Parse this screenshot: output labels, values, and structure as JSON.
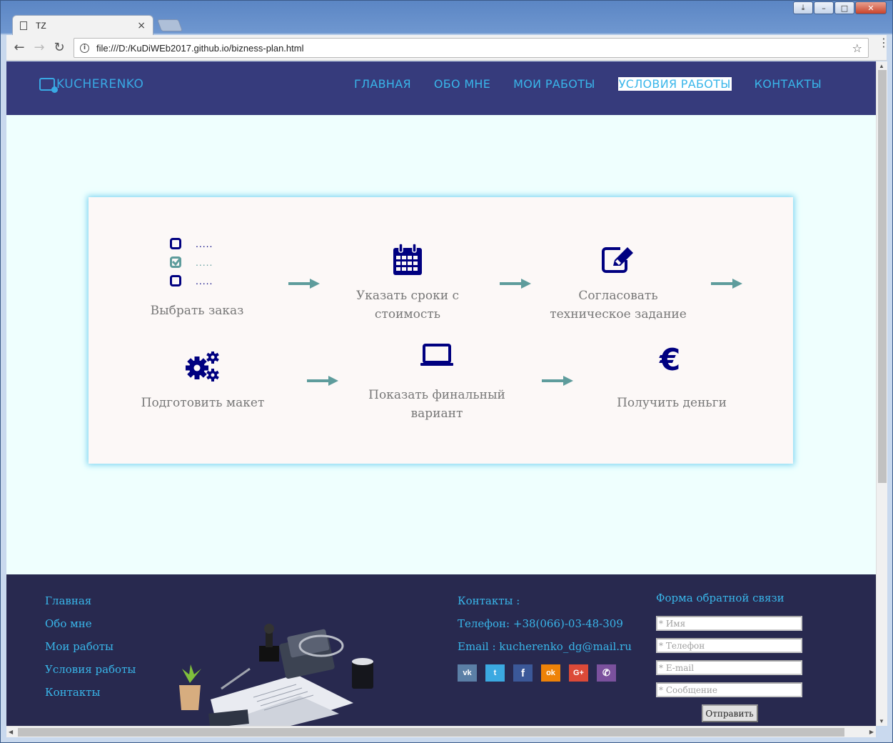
{
  "browser": {
    "tab_title": "TZ",
    "tab_close": "×",
    "url": "file:///D:/KuDiWEb2017.github.io/bizness-plan.html",
    "window_controls": [
      "⤓",
      "–",
      "□",
      "✕"
    ]
  },
  "header": {
    "logo": "KUCHERENKO",
    "nav": [
      {
        "label": "ГЛАВНАЯ"
      },
      {
        "label": "ОБО МНЕ"
      },
      {
        "label": "МОИ РАБОТЫ"
      },
      {
        "label": "УСЛОВИЯ РАБОТЫ",
        "active": true
      },
      {
        "label": "КОНТАКТЫ"
      }
    ]
  },
  "steps": {
    "checklist_dots": ".....",
    "items": [
      {
        "label": "Выбрать заказ",
        "icon": "checklist-icon"
      },
      {
        "label": "Указать сроки с стоимость",
        "icon": "calendar-icon"
      },
      {
        "label": "Согласовать техническое задание",
        "icon": "edit-icon"
      },
      {
        "label": "Подготовить макет",
        "icon": "gears-icon"
      },
      {
        "label": "Показать финальный вариант",
        "icon": "laptop-icon"
      },
      {
        "label": "Получить деньги",
        "icon": "euro-icon",
        "glyph": "€"
      }
    ]
  },
  "footer": {
    "links": [
      "Главная",
      "Обо мне",
      "Мои работы",
      "Условия работы",
      "Контакты"
    ],
    "contacts_title": "Контакты :",
    "phone": "Телефон: +38(066)-03-48-309",
    "email": "Email : kucherenko_dg@mail.ru",
    "socials": [
      {
        "name": "vk",
        "glyph": "vk",
        "color": "#5b7fa6"
      },
      {
        "name": "twitter",
        "glyph": "t",
        "color": "#3ba9e1"
      },
      {
        "name": "facebook",
        "glyph": "f",
        "color": "#3b5898"
      },
      {
        "name": "odnoklassniki",
        "glyph": "ok",
        "color": "#ee8208"
      },
      {
        "name": "google-plus",
        "glyph": "G+",
        "color": "#dc4a38"
      },
      {
        "name": "viber",
        "glyph": "✆",
        "color": "#7b519d"
      }
    ],
    "form": {
      "title": "Форма обратной связи",
      "name_placeholder": "* Имя",
      "phone_placeholder": "* Телефон",
      "email_placeholder": "* E-mail",
      "message_placeholder": "* Сообщение",
      "submit": "Отправить"
    }
  },
  "colors": {
    "header_bg": "#363b7c",
    "footer_bg": "#28294f",
    "accent": "#39b6ea",
    "icon": "#000080",
    "arrow": "#5e9c9c"
  }
}
